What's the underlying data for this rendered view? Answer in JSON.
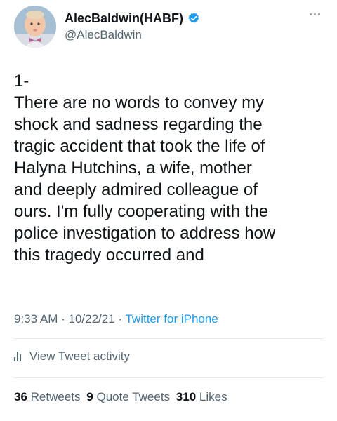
{
  "author": {
    "display_name": "AlecBaldwin(HABF)",
    "handle": "@AlecBaldwin",
    "verified": true
  },
  "tweet": {
    "lines": [
      "1-",
      "There are no words to convey my",
      "shock and sadness regarding the",
      "tragic accident that took the life of",
      "Halyna Hutchins, a wife, mother",
      "and deeply admired colleague of",
      "ours. I'm fully cooperating with the",
      "police investigation to address how",
      "this tragedy occurred and"
    ]
  },
  "meta": {
    "time": "9:33 AM",
    "separator": " · ",
    "date": "10/22/21",
    "source": "Twitter for iPhone"
  },
  "activity": {
    "label": "View Tweet activity"
  },
  "stats": {
    "retweets_count": "36",
    "retweets_label": "Retweets",
    "quote_count": "9",
    "quote_label": "Quote Tweets",
    "likes_count": "310",
    "likes_label": "Likes"
  },
  "colors": {
    "text": "#0f1419",
    "secondary": "#536471",
    "link": "#1d9bf0",
    "divider": "#e1e8ed"
  }
}
